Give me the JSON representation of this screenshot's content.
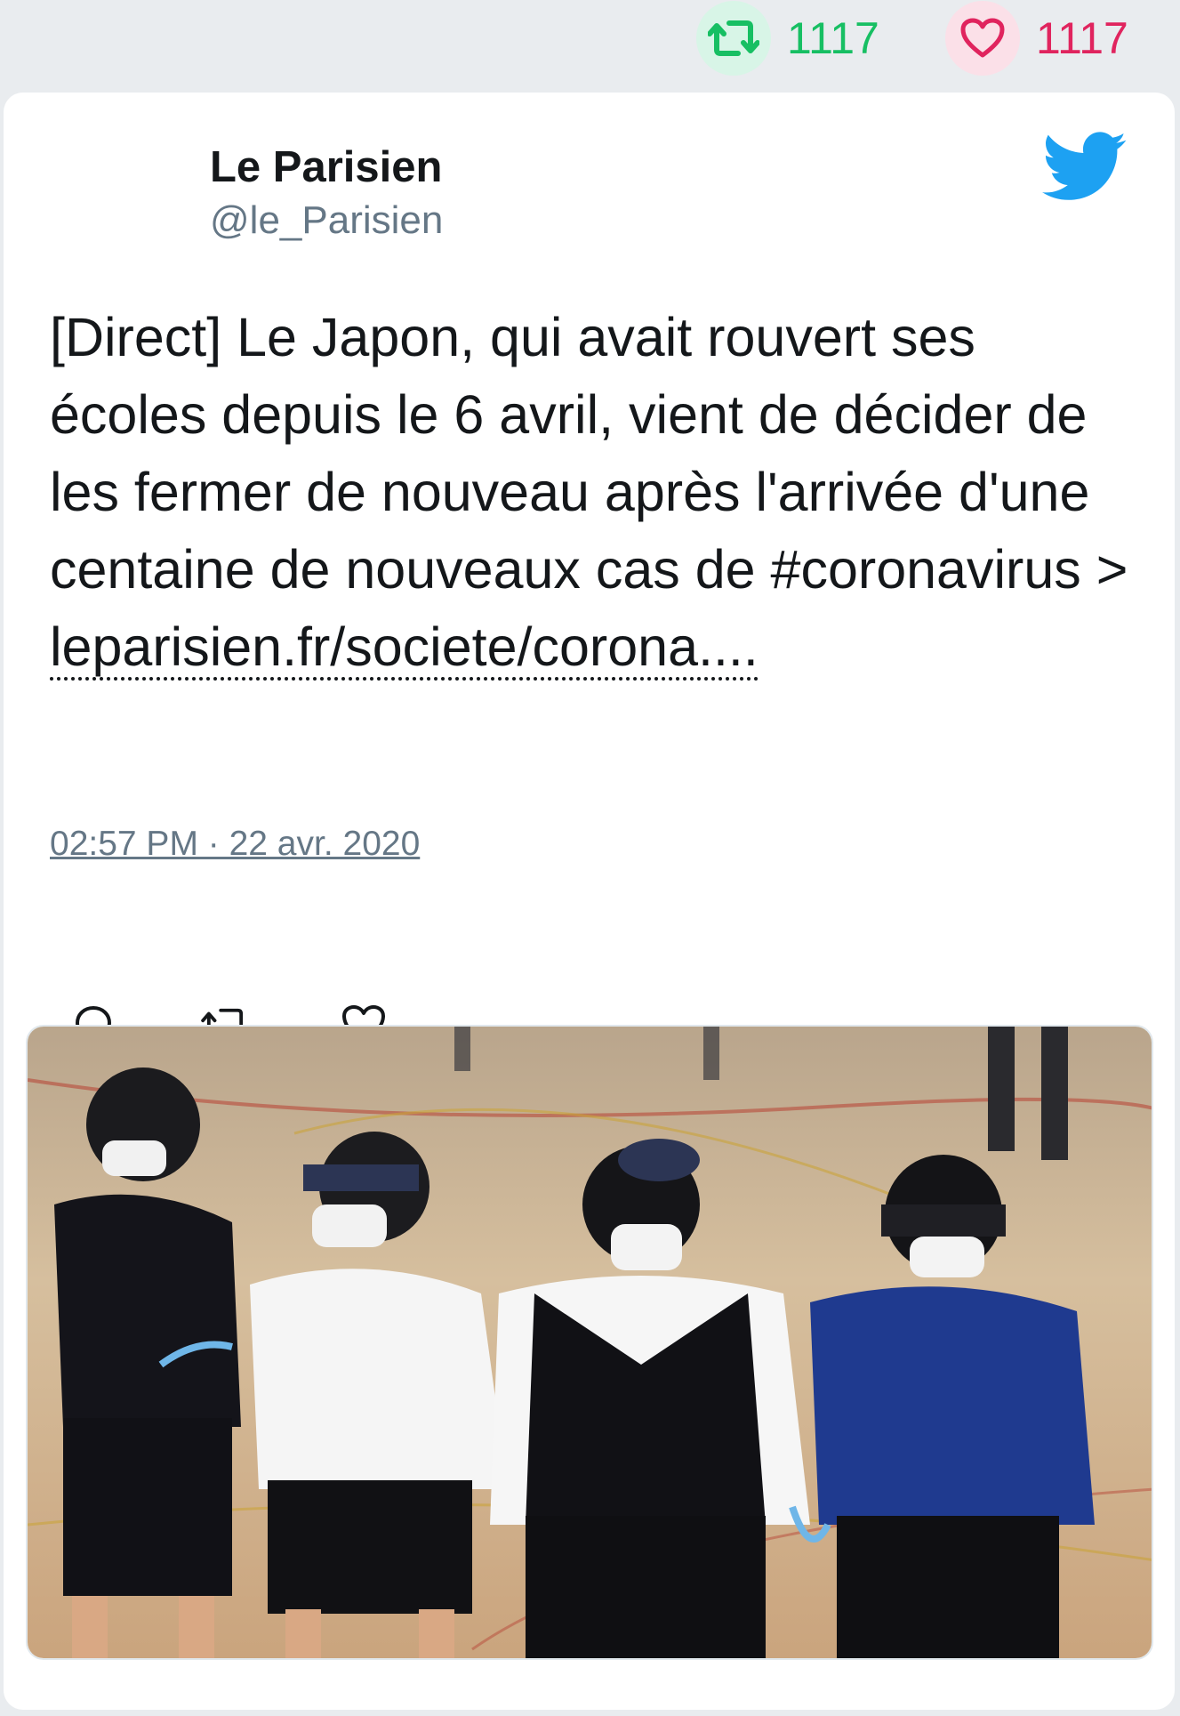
{
  "stats": {
    "retweets": "1117",
    "likes": "1117",
    "retweet_icon": "retweet-icon",
    "like_icon": "heart-icon"
  },
  "tweet": {
    "author_name": "Le Parisien",
    "author_handle": "@le_Parisien",
    "text": "[Direct] Le Japon, qui avait rouvert ses écoles depuis le 6 avril, vient de décider de les fermer de nouveau après l'arrivée d'une centaine de nouveaux cas de #coronavirus >",
    "link_text": "leparisien.fr/societe/corona....",
    "timestamp": "02:57 PM · 22 avr. 2020"
  },
  "colors": {
    "retweet": "#17bf63",
    "like": "#e0245e",
    "twitter_blue": "#1da1f2",
    "muted": "#657786"
  },
  "media": {
    "description_icon": "photo"
  }
}
